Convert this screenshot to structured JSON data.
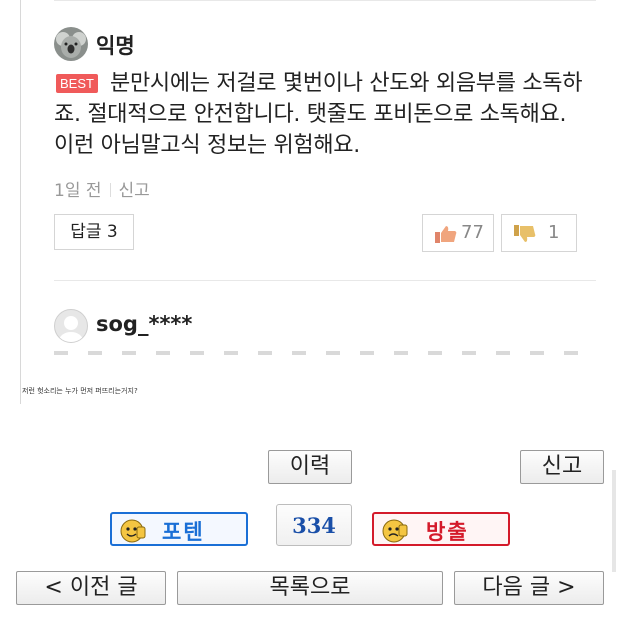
{
  "comments": [
    {
      "author": "익명",
      "badge": "BEST",
      "text": "분만시에는 저걸로 몇번이나 산도와 외음부를 소독하죠. 절대적으로 안전합니다. 탯줄도 포비돈으로 소독해요. 이런 아님말고식 정보는 위험해요.",
      "time": "1일 전",
      "report": "신고",
      "reply_label": "답글 3",
      "likes": "77",
      "dislikes": "1"
    },
    {
      "author": "sog_****"
    }
  ],
  "image_caption": "저런 헛소리는 누가 먼저 퍼뜨리는거지?",
  "controls": {
    "history_label": "이력",
    "report_label": "신고",
    "recommend_label": "포텐",
    "count": "334",
    "ban_label": "방출",
    "prev_label": "< 이전 글",
    "list_label": "목록으로",
    "next_label": "다음 글 >"
  },
  "colors": {
    "best": "#f05a5a",
    "recommend": "#1a6fd6",
    "ban": "#d41a2a"
  }
}
